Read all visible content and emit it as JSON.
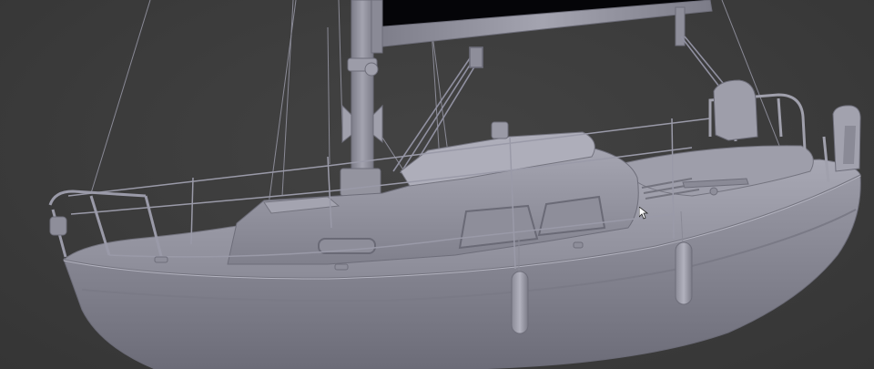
{
  "viewport": {
    "label": "3D viewport",
    "shading": "solid",
    "background_color": "#3d3d3d",
    "model_color": "#8e8e9a",
    "sail_color": "#050508"
  },
  "model": {
    "name": "sailboat",
    "parts": [
      "mast",
      "boom",
      "mainsail",
      "hull",
      "cabin",
      "cockpit",
      "pulpit",
      "pushpit",
      "lifelines",
      "fenders",
      "rigging",
      "outboard-motor"
    ]
  },
  "cursor": {
    "type": "arrow-pointer"
  }
}
